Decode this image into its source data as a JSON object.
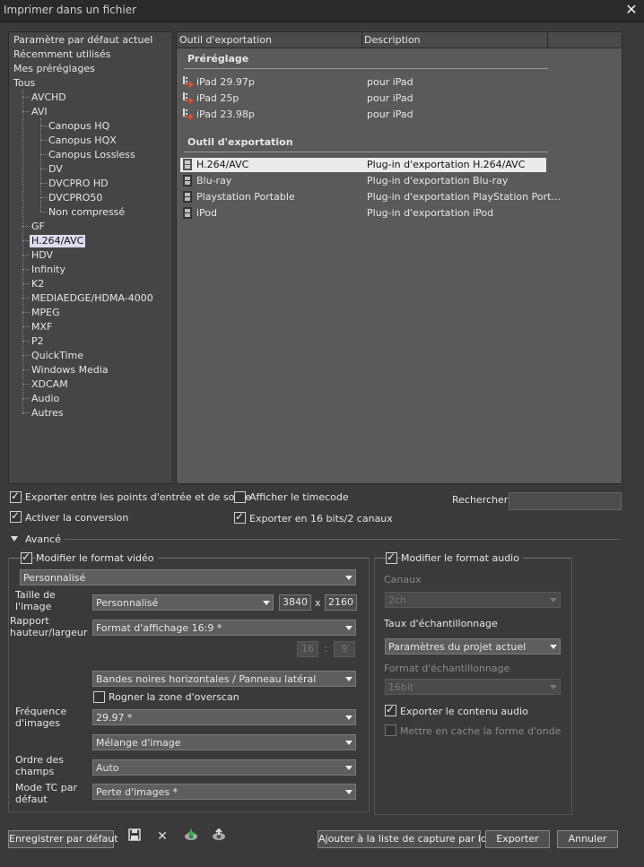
{
  "window": {
    "title": "Imprimer dans un fichier"
  },
  "tree": {
    "top": [
      "Paramètre par défaut actuel",
      "Récemment utilisés",
      "Mes préréglages",
      "Tous"
    ],
    "level1": [
      "AVCHD",
      "AVI",
      "GF",
      "H.264/AVC",
      "HDV",
      "Infinity",
      "K2",
      "MEDIAEDGE/HDMA-4000",
      "MPEG",
      "MXF",
      "P2",
      "QuickTime",
      "Windows Media",
      "XDCAM",
      "Audio",
      "Autres"
    ],
    "avi_children": [
      "Canopus HQ",
      "Canopus HQX",
      "Canopus Lossless",
      "DV",
      "DVCPRO HD",
      "DVCPRO50",
      "Non compressé"
    ],
    "selected": "H.264/AVC"
  },
  "list": {
    "col1": "Outil d'exportation",
    "col2": "Description",
    "preset_group": "Préréglage",
    "presets": [
      {
        "name": "iPad 29.97p",
        "desc": "pour iPad"
      },
      {
        "name": "iPad 25p",
        "desc": "pour iPad"
      },
      {
        "name": "iPad 23.98p",
        "desc": "pour iPad"
      }
    ],
    "tool_group": "Outil d'exportation",
    "tools": [
      {
        "name": "H.264/AVC",
        "desc": "Plug-in d'exportation H.264/AVC"
      },
      {
        "name": "Blu-ray",
        "desc": "Plug-in d'exportation Blu-ray"
      },
      {
        "name": "Playstation Portable",
        "desc": "Plug-in d'exportation PlayStation Port..."
      },
      {
        "name": "iPod",
        "desc": "Plug-in d'exportation iPod"
      }
    ]
  },
  "options": {
    "export_inout": "Exporter entre les points d'entrée et de sortie",
    "show_timecode": "Afficher le timecode",
    "enable_conversion": "Activer la conversion",
    "export_16bit": "Exporter en 16 bits/2 canaux",
    "search_label": "Rechercher",
    "advanced": "Avancé"
  },
  "video": {
    "modify": "Modifier le format vidéo",
    "preset": "Personnalisé",
    "size_label": "Taille de l'image",
    "size_value": "Personnalisé",
    "width": "3840",
    "x": "x",
    "height": "2160",
    "aspect_label": "Rapport hauteur/largeur",
    "aspect_value": "Format d'affichage 16:9 *",
    "ratio_a": "16",
    "ratio_sep": ":",
    "ratio_b": "9",
    "bands": "Bandes noires horizontales / Panneau latéral",
    "crop": "Rogner la zone d'overscan",
    "rate_label": "Fréquence d'images",
    "rate_value": "29.97 *",
    "blend": "Mélange d'image",
    "field_label": "Ordre des champs",
    "field_value": "Auto",
    "tc_label": "Mode TC par défaut",
    "tc_value": "Perte d'images *"
  },
  "audio": {
    "modify": "Modifier le format audio",
    "channels_label": "Canaux",
    "channels_value": "2ch",
    "rate_label": "Taux d'échantillonnage",
    "rate_value": "Paramètres du projet actuel",
    "format_label": "Format d'échantillonnage",
    "format_value": "16bit",
    "export_audio": "Exporter le contenu audio",
    "cache_wave": "Mettre en cache la forme d'onde"
  },
  "buttons": {
    "save_default": "Enregistrer par défaut",
    "add_batch": "Ajouter à la liste de capture par lots",
    "export": "Exporter",
    "cancel": "Annuler"
  },
  "icons": [
    "save-icon",
    "delete-icon",
    "import-preset-icon",
    "export-preset-icon"
  ]
}
